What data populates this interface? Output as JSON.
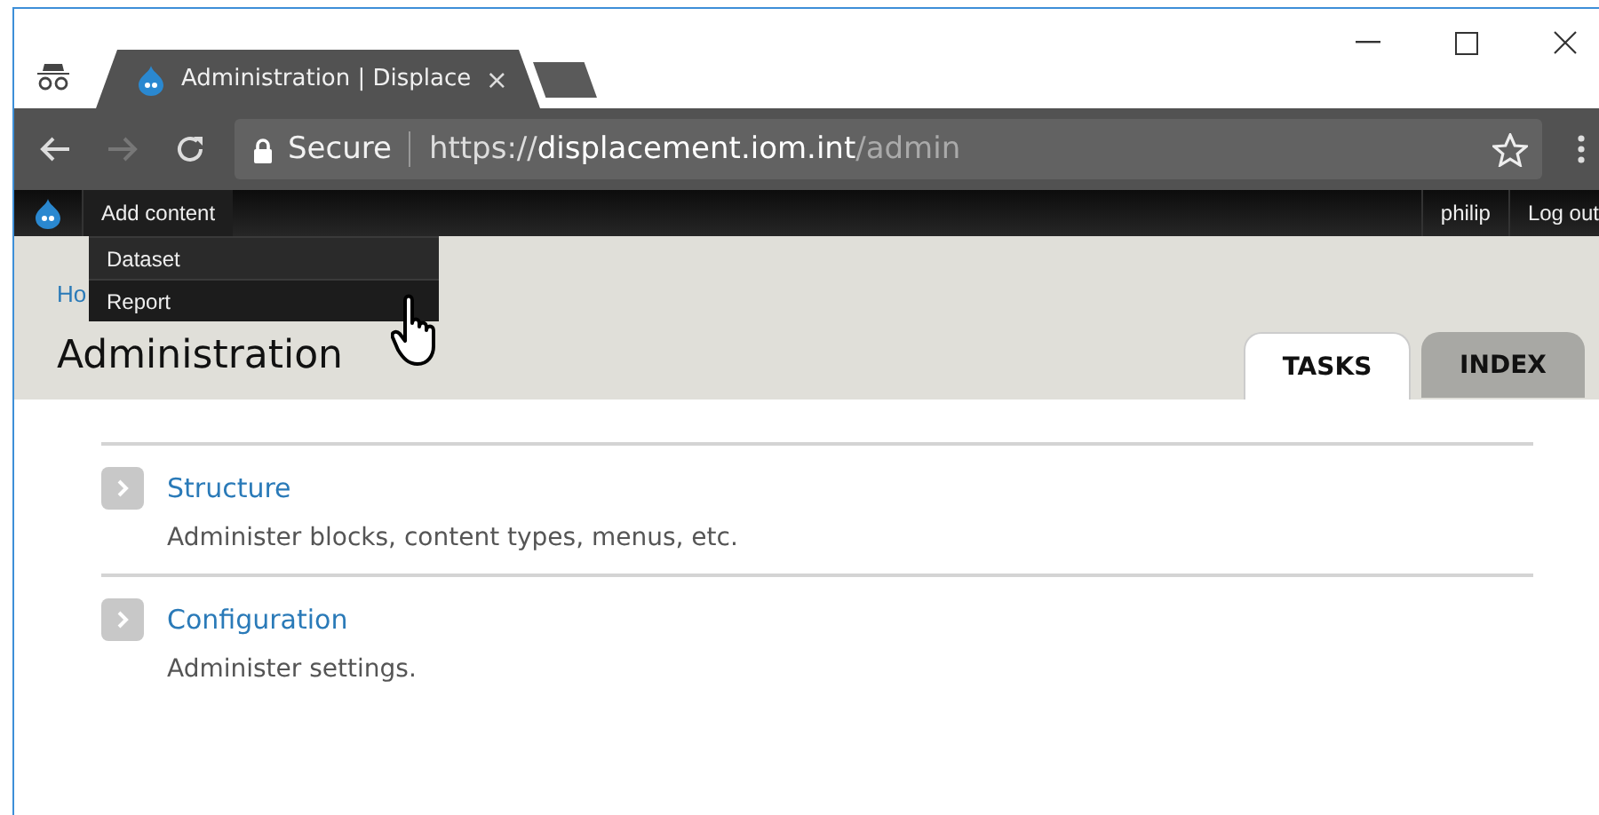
{
  "browser": {
    "tab_title": "Administration | Displace",
    "tab_close": "×",
    "secure_label": "Secure",
    "url_scheme": "https://",
    "url_host": "displacement.iom.int",
    "url_path": "/admin"
  },
  "toolbar": {
    "items": [
      {
        "label": "Add content",
        "expanded": true
      }
    ],
    "user": "philip",
    "logout": "Log out"
  },
  "dropdown": [
    {
      "label": "Dataset",
      "hovered": false
    },
    {
      "label": "Report",
      "hovered": true
    }
  ],
  "breadcrumb": "Ho",
  "page_title": "Administration",
  "tabs": [
    {
      "label": "TASKS",
      "selected": true
    },
    {
      "label": "INDEX",
      "selected": false
    }
  ],
  "sections": [
    {
      "title": "Structure",
      "description": "Administer blocks, content types, menus, etc."
    },
    {
      "title": "Configuration",
      "description": "Administer settings."
    }
  ]
}
